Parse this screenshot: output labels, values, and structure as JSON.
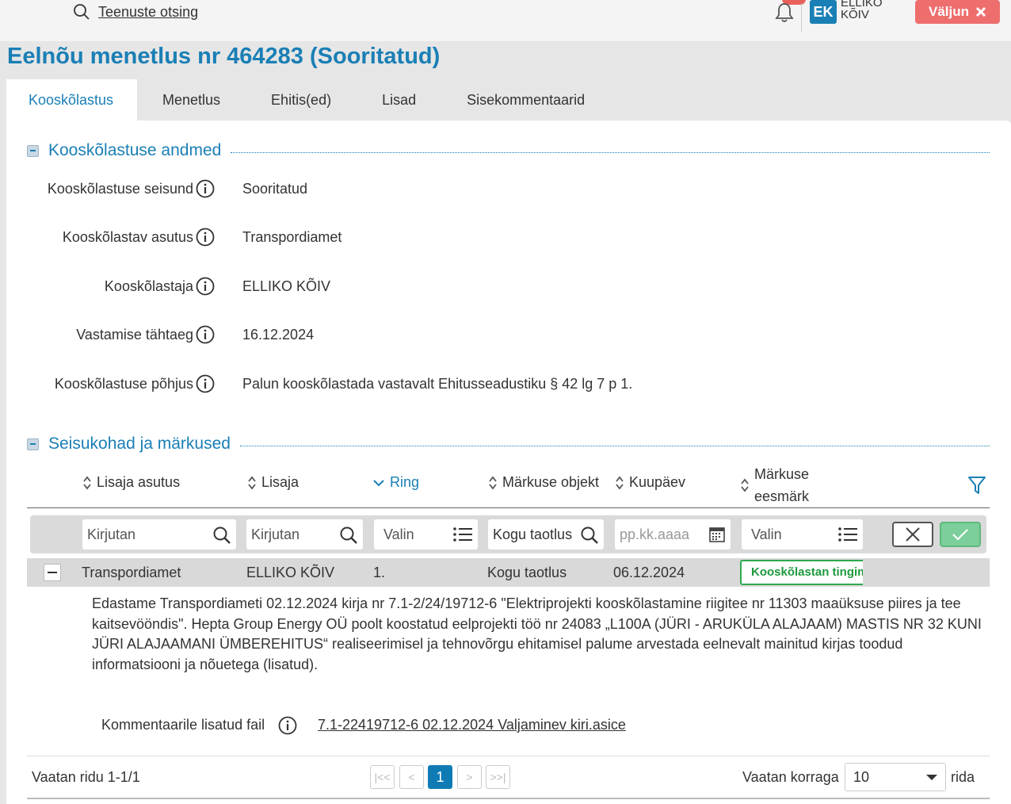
{
  "topbar": {
    "search_label": "Teenuste otsing",
    "user_initials": "EK",
    "user_name": "ELLIKO KÕIV",
    "logout_label": "Väljun"
  },
  "page_title": "Eelnõu menetlus nr 464283 (Sooritatud)",
  "tabs": [
    {
      "label": "Kooskõlastus",
      "active": true
    },
    {
      "label": "Menetlus"
    },
    {
      "label": "Ehitis(ed)"
    },
    {
      "label": "Lisad"
    },
    {
      "label": "Sisekommentaarid"
    }
  ],
  "section1": {
    "title": "Kooskõlastuse andmed",
    "fields": [
      {
        "label": "Kooskõlastuse seisund",
        "value": "Sooritatud"
      },
      {
        "label": "Kooskõlastav asutus",
        "value": "Transpordiamet"
      },
      {
        "label": "Kooskõlastaja",
        "value": "ELLIKO KÕIV"
      },
      {
        "label": "Vastamise tähtaeg",
        "value": "16.12.2024"
      },
      {
        "label": "Kooskõlastuse põhjus",
        "value": "Palun kooskõlastada vastavalt Ehitusseadustiku § 42 lg 7 p 1."
      }
    ]
  },
  "section2": {
    "title": "Seisukohad ja märkused",
    "columns": {
      "asutus": "Lisaja asutus",
      "lisaja": "Lisaja",
      "ring": "Ring",
      "objekt": "Märkuse objekt",
      "kuupaev": "Kuupäev",
      "eesmark_line1": "Märkuse",
      "eesmark_line2": "eesmärk"
    },
    "filters": {
      "asutus_placeholder": "Kirjutan",
      "lisaja_placeholder": "Kirjutan",
      "ring_placeholder": "Valin",
      "objekt_value": "Kogu taotlus",
      "kuupaev_placeholder": "pp.kk.aaaa",
      "eesmark_placeholder": "Valin"
    },
    "row": {
      "asutus": "Transpordiamet",
      "lisaja": "ELLIKO KÕIV",
      "ring": "1.",
      "objekt": "Kogu taotlus",
      "kuupaev": "06.12.2024",
      "eesmark": "Kooskõlastan tingimustega"
    },
    "comment": "Edastame Transpordiameti 02.12.2024 kirja nr 7.1-2/24/19712-6 \"Elektriprojekti kooskõlastamine riigitee nr 11303 maaüksuse piires ja tee kaitsevööndis\". Hepta Group Energy OÜ poolt koostatud eelprojekti töö nr 24083 „L100A (JÜRI - ARUKÜLA ALAJAAM) MASTIS NR 32 KUNI JÜRI ALAJAAMANI ÜMBEREHITUS“ realiseerimisel ja tehnovõrgu ehitamisel palume arvestada eelnevalt mainitud  kirjas toodud informatsiooni ja nõuetega (lisatud).",
    "attachment_label": "Kommentaarile lisatud fail",
    "attachment_file": "7.1-22419712-6 02.12.2024 Valjaminev kiri.asice"
  },
  "pager": {
    "summary": "Vaatan ridu 1-1/1",
    "current_page": "1",
    "per_page_label": "Vaatan korraga",
    "per_page_value": "10",
    "rows_suffix": "rida"
  },
  "colors": {
    "accent": "#1a7fb5",
    "logout": "#ee6e6e",
    "badge_green": "#2eaa4f"
  }
}
